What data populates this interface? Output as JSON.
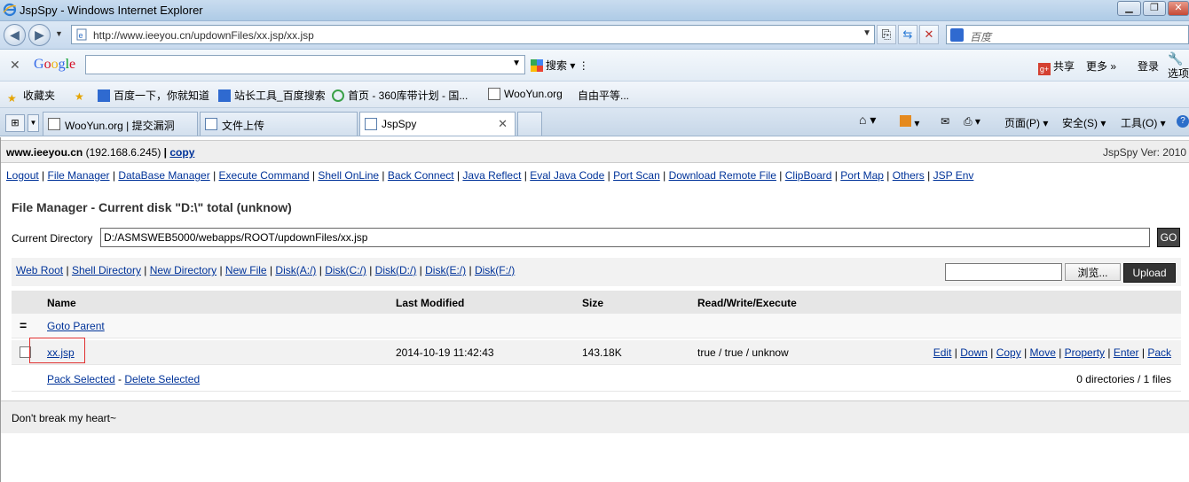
{
  "window": {
    "title": "JspSpy - Windows Internet Explorer"
  },
  "address": {
    "url": "http://www.ieeyou.cn/updownFiles/xx.jsp/xx.jsp",
    "search_placeholder": "百度"
  },
  "google_toolbar": {
    "logo": "Google",
    "search_label": "搜索",
    "share_label": "共享",
    "more_label": "更多 »",
    "login_label": "登录",
    "options_label": "选项"
  },
  "favorites": {
    "label": "收藏夹",
    "items": [
      "百度一下，你就知道",
      "站长工具_百度搜索",
      "首页 - 360库带计划 - 国...",
      "WooYun.org",
      "自由平等..."
    ]
  },
  "tabs": [
    "WooYun.org | 提交漏洞",
    "文件上传",
    "JspSpy"
  ],
  "commandbar": {
    "page": "页面(P)",
    "safety": "安全(S)",
    "tools": "工具(O)"
  },
  "page": {
    "host": "www.ieeyou.cn",
    "ip": "(192.168.6.245)",
    "copy": "copy",
    "version": "JspSpy Ver: 2010",
    "menu": [
      "Logout",
      "File Manager",
      "DataBase Manager",
      "Execute Command",
      "Shell OnLine",
      "Back Connect",
      "Java Reflect",
      "Eval Java Code",
      "Port Scan",
      "Download Remote File",
      "ClipBoard",
      "Port Map",
      "Others",
      "JSP Env"
    ],
    "title": "File Manager - Current disk \"D:\\\" total (unknow)",
    "current_dir_label": "Current Directory",
    "current_dir": "D:/ASMSWEB5000/webapps/ROOT/updownFiles/xx.jsp",
    "go": "GO",
    "quicklinks": [
      "Web Root",
      "Shell Directory",
      "New Directory",
      "New File",
      "Disk(A:/)",
      "Disk(C:/)",
      "Disk(D:/)",
      "Disk(E:/)",
      "Disk(F:/)"
    ],
    "browse": "浏览...",
    "upload": "Upload",
    "columns": {
      "name": "Name",
      "modified": "Last Modified",
      "size": "Size",
      "rwx": "Read/Write/Execute"
    },
    "goto_parent": "Goto Parent",
    "file": {
      "name": "xx.jsp",
      "modified": "2014-10-19 11:42:43",
      "size": "143.18K",
      "rwx": "true / true / unknow",
      "actions": [
        "Edit",
        "Down",
        "Copy",
        "Move",
        "Property",
        "Enter",
        "Pack"
      ]
    },
    "pack_selected": "Pack Selected",
    "delete_selected": "Delete Selected",
    "summary": "0 directories / 1 files",
    "footer": "Don't break my heart~"
  }
}
